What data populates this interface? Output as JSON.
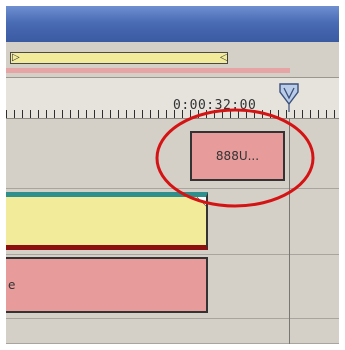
{
  "timeline": {
    "timecode": "0:00:32:00",
    "clips": {
      "short_clip_label": "888U...",
      "pink_clip_label": "e"
    }
  },
  "colors": {
    "title_bar": "#4a6cb5",
    "work_area": "#f2ec9a",
    "clip_pink": "#e79b9b",
    "clip_teal_edge": "#2f8f8c",
    "clip_red_edge": "#8c1010",
    "annotation_circle": "#d41414",
    "panel_bg": "#d4d0c8"
  },
  "icons": {
    "playhead": "playhead-marker-icon",
    "work_area_bracket": "bracket-icon"
  }
}
